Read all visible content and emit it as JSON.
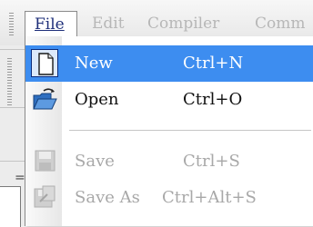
{
  "menubar": {
    "items": [
      {
        "label": "File",
        "state": "open"
      },
      {
        "label": "Edit",
        "state": "disabled"
      },
      {
        "label": "Compiler",
        "state": "disabled"
      },
      {
        "label": "Comm",
        "state": "disabled"
      }
    ]
  },
  "file_menu": {
    "items": [
      {
        "label": "New",
        "shortcut": "Ctrl+N",
        "icon": "new-document-icon",
        "state": "highlighted"
      },
      {
        "label": "Open",
        "shortcut": "Ctrl+O",
        "icon": "open-folder-icon",
        "state": "enabled"
      },
      {
        "label": "Save",
        "shortcut": "Ctrl+S",
        "icon": "save-icon",
        "state": "disabled"
      },
      {
        "label": "Save As",
        "shortcut": "Ctrl+Alt+S",
        "icon": "save-as-icon",
        "state": "disabled"
      }
    ]
  },
  "left_strip": {
    "mark": "="
  },
  "colors": {
    "highlight": "#3d8df0",
    "disabled_text": "#a8a8a8",
    "menu_title": "#1f2f7a"
  }
}
